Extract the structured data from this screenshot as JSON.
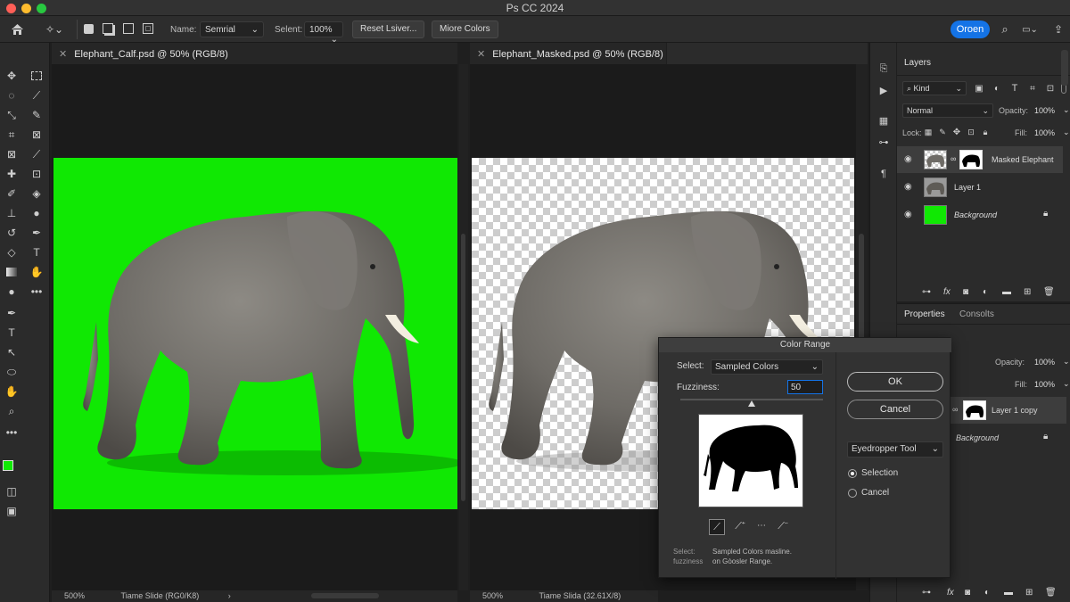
{
  "app": {
    "title": "Ps CC 2024"
  },
  "options_bar": {
    "name_label": "Name:",
    "name_value": "Semrial",
    "select_label": "Selent:",
    "select_value": "100%",
    "reset_button": "Reset Lsiver...",
    "more_colors_button": "Miore Colors",
    "open_button": "Oroen"
  },
  "documents": [
    {
      "tab": "Elephant_Calf.psd @ 50% (RGB/8)",
      "zoom": "500%",
      "status": "Tiame Slide (RG0/K8)"
    },
    {
      "tab": "Elephant_Masked.psd @ 50% (RGB/8)",
      "zoom": "500%",
      "status": "Tiame Slida (32.61X/8)"
    }
  ],
  "layers_panel": {
    "title": "Layers",
    "filter": "Kind",
    "blend_mode": "Normal",
    "opacity_label": "Opacity:",
    "opacity": "100%",
    "lock_label": "Lock:",
    "fill_label": "Fill:",
    "fill": "100%",
    "layers": [
      {
        "name": "Masked Elephant"
      },
      {
        "name": "Layer 1"
      },
      {
        "name": "Background"
      }
    ]
  },
  "properties_panel": {
    "tabs": [
      "Properties",
      "Consolts"
    ],
    "opacity_label": "Opacity:",
    "opacity": "100%",
    "fill_label": "Fill:",
    "fill": "100%",
    "layers": [
      {
        "name": "Layer 1 copy"
      },
      {
        "name": "Background"
      }
    ]
  },
  "color_range_dialog": {
    "title": "Color Range",
    "select_label": "Select:",
    "select_value": "Sampled Colors",
    "fuzziness_label": "Fuzziness:",
    "fuzziness_value": "50",
    "fuzziness_level": 0.5,
    "ok_button": "OK",
    "cancel_button": "Cancel",
    "tool_select": "Eyedropper  Tool",
    "radio_selection": "Selection",
    "radio_cancel": "Cancel",
    "footer_left": "Select:\nfuzziness",
    "footer_right": "Sampled Colors masline.\non Gòosler Range."
  },
  "colors": {
    "green_screen": "#10e803",
    "accent_blue": "#1473e6"
  }
}
